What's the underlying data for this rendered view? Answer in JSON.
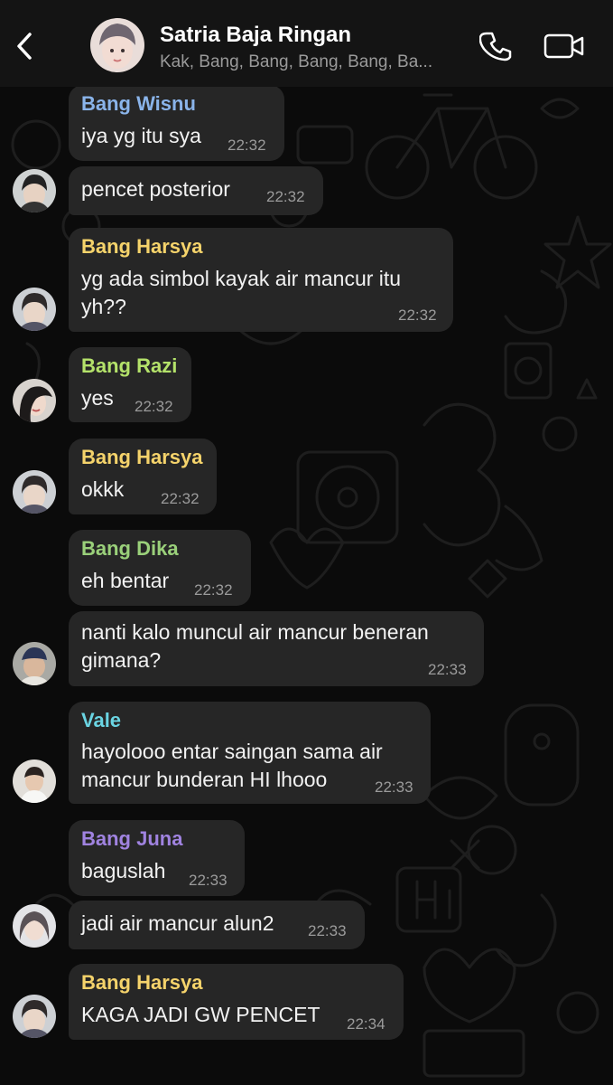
{
  "header": {
    "title": "Satria Baja Ringan",
    "subtitle": "Kak, Bang, Bang, Bang, Bang, Ba..."
  },
  "colors": {
    "wisnu": "#8ab4ea",
    "harsya": "#f5d36b",
    "razi": "#b4e26a",
    "dika": "#9ad07a",
    "vale": "#6ad4e2",
    "juna": "#a083e0"
  },
  "messages": [
    {
      "sender": "Bang Wisnu",
      "text1": "iya yg itu sya",
      "time": "22:32"
    },
    {
      "text1": "pencet posterior",
      "time": "22:32"
    },
    {
      "sender": "Bang Harsya",
      "text1": "yg ada simbol kayak air mancur itu",
      "text2": "yh??",
      "time": "22:32"
    },
    {
      "sender": "Bang Razi",
      "text1": "yes",
      "time": "22:32"
    },
    {
      "sender": "Bang Harsya",
      "text1": "okkk",
      "time": "22:32"
    },
    {
      "sender": "Bang Dika",
      "text1": "eh bentar",
      "time": "22:32"
    },
    {
      "text1": "nanti kalo muncul air mancur beneran",
      "text2": "gimana?",
      "time": "22:33"
    },
    {
      "sender": "Vale",
      "text1": "hayolooo entar saingan sama air",
      "text2": "mancur bunderan HI lhooo",
      "time": "22:33"
    },
    {
      "sender": "Bang Juna",
      "text1": "baguslah",
      "time": "22:33"
    },
    {
      "text1": "jadi air mancur alun2",
      "time": "22:33"
    },
    {
      "sender": "Bang Harsya",
      "text1": "KAGA JADI GW PENCET",
      "time": "22:34"
    }
  ]
}
